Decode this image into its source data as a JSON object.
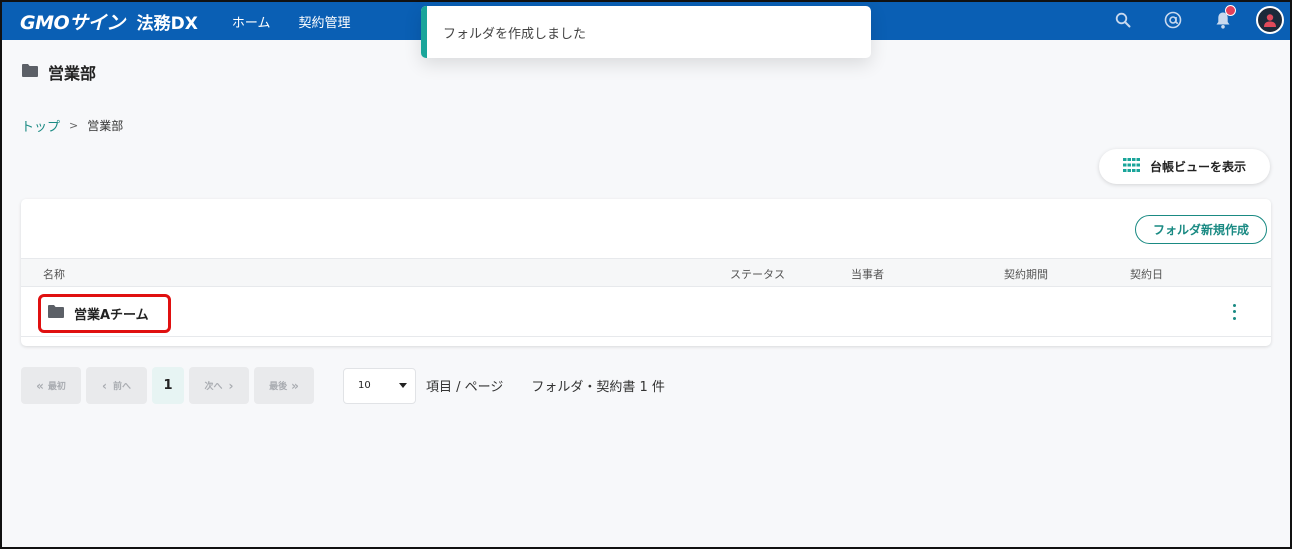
{
  "header": {
    "logo": "GMOサイン",
    "product": "法務DX",
    "nav": [
      "ホーム",
      "契約管理"
    ],
    "icons": [
      "search-icon",
      "mention-icon",
      "bell-icon",
      "user-avatar-icon"
    ],
    "accent_color": "#0a5fb4"
  },
  "toast": {
    "message": "フォルダを作成しました",
    "accent_color": "#1aa59a"
  },
  "page": {
    "title": "営業部"
  },
  "breadcrumb": {
    "home": "トップ",
    "separator": ">",
    "current": "営業部"
  },
  "ledger_button": {
    "label": "台帳ビューを表示"
  },
  "new_folder_button": {
    "label": "フォルダ新規作成"
  },
  "table": {
    "headers": {
      "name": "名称",
      "status": "ステータス",
      "party": "当事者",
      "period": "契約期間",
      "date": "契約日"
    },
    "rows": [
      {
        "name": "営業Aチーム"
      }
    ]
  },
  "pagination": {
    "first": "最初",
    "prev": "前へ",
    "current": "1",
    "next": "次へ",
    "last": "最後",
    "per_page_value": "10",
    "per_page_label": "項目 / ページ",
    "count_text": "フォルダ・契約書 1 件"
  }
}
